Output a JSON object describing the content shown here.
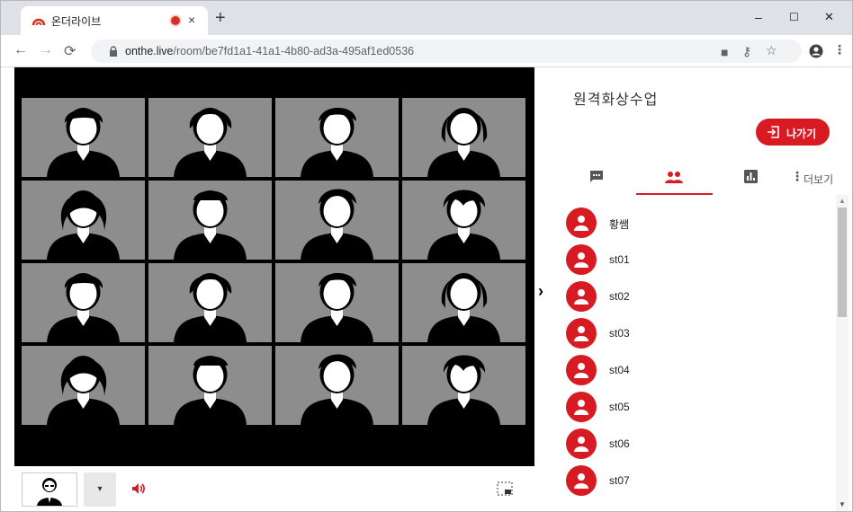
{
  "browser": {
    "tab_title": "온더라이브",
    "new_tab": "+",
    "tab_close": "×",
    "window_controls": {
      "minimize": "–",
      "maximize": "☐",
      "close": "✕"
    },
    "url_host": "onthe.live",
    "url_path": "/room/be7fd1a1-41a1-4b80-ad3a-495af1ed0536",
    "accent": "#d93025"
  },
  "video": {
    "tile_count": 16
  },
  "bottom_bar": {
    "dropdown_arrow": "▾"
  },
  "panel": {
    "room_title": "원격화상수업",
    "exit_label": "나가기",
    "more_label": "더보기",
    "tabs": [
      "chat-icon",
      "participants-icon",
      "poll-icon"
    ],
    "participants": [
      "황쌤",
      "st01",
      "st02",
      "st03",
      "st04",
      "st05",
      "st06",
      "st07"
    ],
    "accent": "#d81b23"
  }
}
